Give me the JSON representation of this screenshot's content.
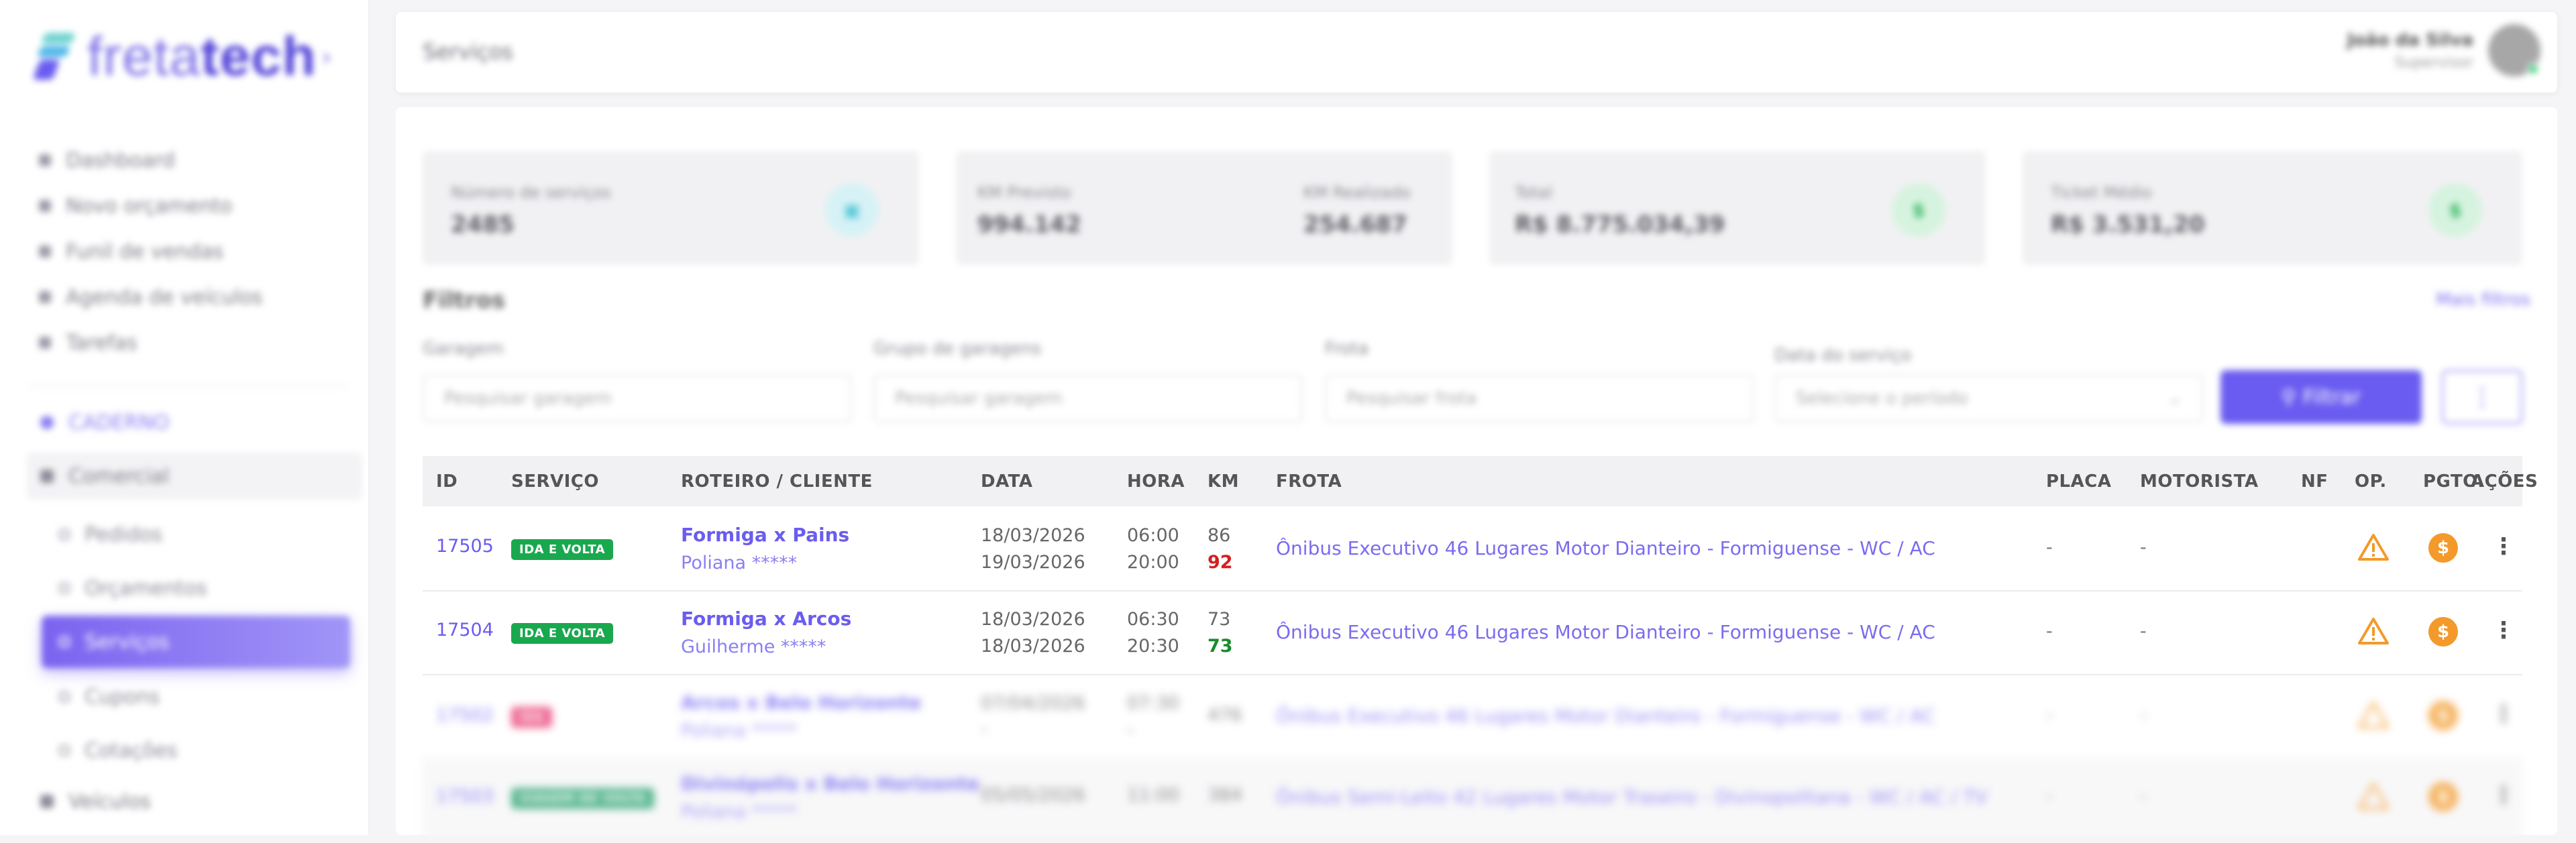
{
  "sidebar": {
    "brand_light": "freta",
    "brand_bold": "tech",
    "menu": [
      {
        "label": "Dashboard"
      },
      {
        "label": "Novo orçamento"
      },
      {
        "label": "Funil de vendas"
      },
      {
        "label": "Agenda de veículos"
      },
      {
        "label": "Tarefas"
      }
    ],
    "section_label": "CADERNO",
    "group_label": "Comercial",
    "sub_items": [
      {
        "label": "Pedidos"
      },
      {
        "label": "Orçamentos"
      },
      {
        "label": "Serviços"
      },
      {
        "label": "Cupons"
      },
      {
        "label": "Cotações"
      }
    ],
    "bottom_label": "Veículos"
  },
  "header": {
    "page_title": "Serviços",
    "user_name": "João da Silva",
    "user_role": "Supervisor"
  },
  "stats": {
    "services_label": "Número de serviços",
    "services_value": "2485",
    "km_planned_label": "KM Previsto",
    "km_planned_value": "994.142",
    "km_done_label": "KM Realizado",
    "km_done_value": "254.687",
    "total_label": "Total",
    "total_value": "R$ 8.775.034,39",
    "ticket_label": "Ticket Médio",
    "ticket_value": "R$ 3.531,20"
  },
  "filters": {
    "title": "Filtros",
    "more_link": "Mais filtros",
    "garage_label": "Garagem",
    "garage_placeholder": "Pesquisar garagem",
    "garage_group_label": "Grupo de garagens",
    "garage_group_placeholder": "Pesquisar garagem",
    "fleet_label": "Frota",
    "fleet_placeholder": "Pesquisar frota",
    "date_label": "Data do serviço",
    "date_placeholder": "Selecione o período",
    "filter_button": "Filtrar",
    "more_button": "⋮"
  },
  "table": {
    "headers": {
      "id": "ID",
      "servico": "SERVIÇO",
      "roteiro": "ROTEIRO / CLIENTE",
      "data": "DATA",
      "hora": "HORA",
      "km": "KM",
      "frota": "FROTA",
      "placa": "PLACA",
      "motorista": "MOTORISTA",
      "nf": "NF",
      "op": "OP.",
      "pgto": "PGTO.",
      "acoes": "AÇÕES"
    },
    "rows": [
      {
        "id": "17505",
        "servico": "IDA E VOLTA",
        "roteiro": "Formiga x Pains",
        "cliente": "Poliana *****",
        "data1": "18/03/2026",
        "data2": "19/03/2026",
        "hora1": "06:00",
        "hora2": "20:00",
        "km1": "86",
        "km2": "92",
        "km2_color": "#d42020",
        "frota": "Ônibus Executivo 46 Lugares Motor Dianteiro - Formiguense - WC / AC",
        "placa": "-",
        "motorista": "-"
      },
      {
        "id": "17504",
        "servico": "IDA E VOLTA",
        "roteiro": "Formiga x Arcos",
        "cliente": "Guilherme *****",
        "data1": "18/03/2026",
        "data2": "18/03/2026",
        "hora1": "06:30",
        "hora2": "20:30",
        "km1": "73",
        "km2": "73",
        "km2_color": "#1a8a2e",
        "frota": "Ônibus Executivo 46 Lugares Motor Dianteiro - Formiguense - WC / AC",
        "placa": "-",
        "motorista": "-"
      },
      {
        "id": "17502",
        "servico": "IDA",
        "roteiro": "Arcos x Belo Horizonte",
        "cliente": "Poliana *****",
        "data1": "07/04/2026",
        "data2": "-",
        "hora1": "07:30",
        "hora2": "-",
        "km1": "476",
        "km2": "",
        "frota": "Ônibus Executivo 46 Lugares Motor Dianteiro - Formiguense - WC / AC",
        "placa": "-",
        "motorista": "-"
      },
      {
        "id": "17503",
        "servico": "VIAGEM DE VOLTA",
        "roteiro": "Divinópolis x Belo Horizonte",
        "cliente": "Poliana *****",
        "data1": "05/05/2026",
        "data2": "",
        "hora1": "11:00",
        "hora2": "",
        "km1": "384",
        "km2": "",
        "frota": "Ônibus Semi-Leito 42 Lugares Motor Traseiro - Divinopolitana - WC / AC / TV",
        "placa": "-",
        "motorista": "-"
      }
    ]
  },
  "colors": {
    "accent": "#6a5cf0",
    "badge_green": "#1aa84f",
    "badge_pink": "#e8336d",
    "badge_teal": "#1f9e6a",
    "warning": "#f39a2a"
  }
}
